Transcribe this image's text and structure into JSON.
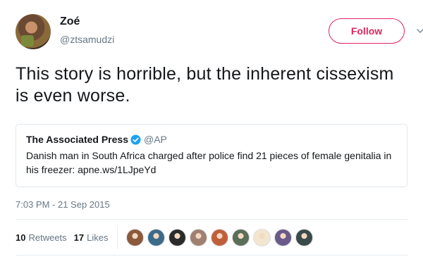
{
  "author": {
    "name": "Zoé",
    "handle": "@ztsamudzi"
  },
  "follow_label": "Follow",
  "tweet_text": "This story is horrible, but the inherent cissexism is even worse.",
  "quoted": {
    "name": "The Associated Press",
    "handle": "@AP",
    "text": "Danish man in South Africa charged after police find 21 pieces of female genitalia in his freezer: apne.ws/1LJpeYd"
  },
  "timestamp": "7:03 PM - 21 Sep 2015",
  "stats": {
    "retweets_count": "10",
    "retweets_label": "Retweets",
    "likes_count": "17",
    "likes_label": "Likes"
  },
  "likers": [
    {
      "color": "#8b5a3c"
    },
    {
      "color": "#3d6a8a"
    },
    {
      "color": "#2b2b2b"
    },
    {
      "color": "#a08070"
    },
    {
      "color": "#c0603a"
    },
    {
      "color": "#5a6e58"
    },
    {
      "color": "#f2e6d0"
    },
    {
      "color": "#6a5a8a"
    },
    {
      "color": "#3a4a4a"
    }
  ],
  "colors": {
    "follow_accent": "#e0245e",
    "verified_blue": "#1da1f2",
    "muted_text": "#657786"
  },
  "icons": [
    "caret-down-icon",
    "verified-badge-icon"
  ]
}
